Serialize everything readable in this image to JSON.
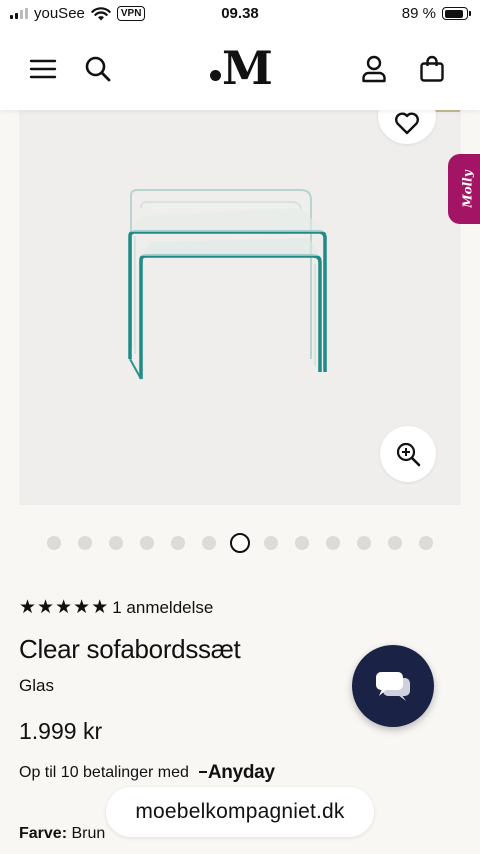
{
  "status_bar": {
    "carrier": "youSee",
    "vpn": "VPN",
    "time": "09.38",
    "battery_percent_label": "89 %",
    "battery_level": 0.89
  },
  "header": {
    "logo_text": "M",
    "menu_icon": "hamburger-icon",
    "search_icon": "search-icon",
    "account_icon": "user-icon",
    "cart_icon": "shopping-bag-icon"
  },
  "gallery": {
    "image_alt": "Clear sofabordssæt glass nesting tables",
    "slide_count": 13,
    "active_index": 6,
    "wishlist_icon": "heart-icon",
    "zoom_icon": "zoom-in-icon"
  },
  "molly_tab": {
    "label": "Molly"
  },
  "product": {
    "rating_stars": 5,
    "reviews_label": "1 anmeldelse",
    "title": "Clear sofabordssæt",
    "material": "Glas",
    "price": "1.999 kr",
    "installment_text": "Op til 10 betalinger med",
    "installment_brand": "Anyday",
    "color_label": "Farve:",
    "color_value": "Brun"
  },
  "chat": {
    "icon": "chat-bubbles-icon"
  },
  "browser": {
    "url": "moebelkompagniet.dk"
  },
  "colors": {
    "chat_bg": "#1a2246",
    "molly_bg": "#a41465",
    "accent_gold": "#c6bb8f"
  }
}
